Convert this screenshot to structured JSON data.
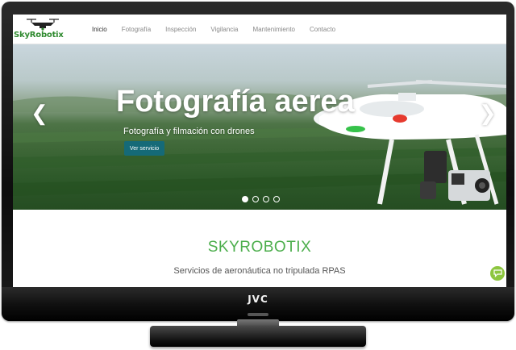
{
  "brand": {
    "logo_text": "SkyRobotix"
  },
  "nav": {
    "items": [
      {
        "label": "Inicio"
      },
      {
        "label": "Fotografía"
      },
      {
        "label": "Inspección"
      },
      {
        "label": "Vigilancia"
      },
      {
        "label": "Mantenimiento"
      },
      {
        "label": "Contacto"
      }
    ],
    "active": "Inicio"
  },
  "hero": {
    "title": "Fotografía aerea",
    "subtitle": "Fotografía y filmación con drones",
    "button_label": "Ver servicio",
    "prev_icon": "chevron-left-icon",
    "next_icon": "chevron-right-icon",
    "slides_count": 4,
    "active_slide": 1
  },
  "section": {
    "heading": "SKYROBOTIX",
    "subheading": "Servicios de aeronáutica no tripulada RPAS"
  },
  "chat": {
    "icon": "chat-icon"
  },
  "tv": {
    "brand": "JVC"
  },
  "colors": {
    "brand_green": "#4cae4c",
    "button_teal": "#156a78",
    "chat_green": "#8dc63f"
  }
}
